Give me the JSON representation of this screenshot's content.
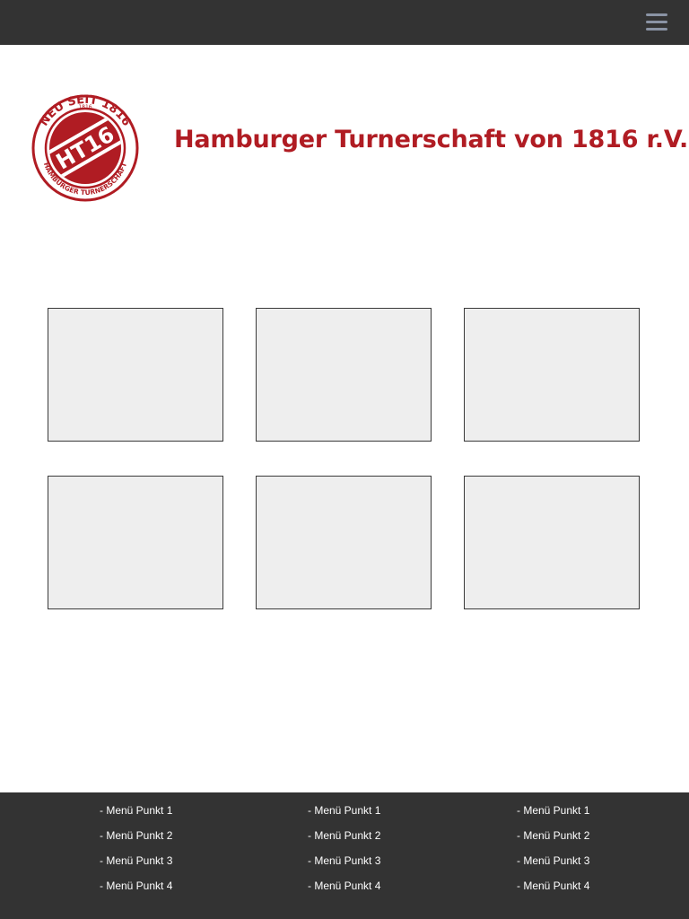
{
  "header": {
    "menu_icon": "hamburger-menu-icon",
    "menu_icon_color": "#8a93a4",
    "background": "#333333"
  },
  "logo": {
    "top_text": "NEU SEIT 1816",
    "year": "1816",
    "center_text": "HT16",
    "bottom_text": "HAMBURGER TURNERSCHAFT",
    "color": "#b01c23"
  },
  "site_title": "Hamburger Turnerschaft von 1816 r.V.",
  "tiles": [
    {
      "id": "tile-1"
    },
    {
      "id": "tile-2"
    },
    {
      "id": "tile-3"
    },
    {
      "id": "tile-4"
    },
    {
      "id": "tile-5"
    },
    {
      "id": "tile-6"
    }
  ],
  "footer": {
    "columns": [
      {
        "links": [
          "- Menü Punkt 1",
          "- Menü Punkt 2",
          "- Menü Punkt 3",
          "- Menü Punkt 4"
        ]
      },
      {
        "links": [
          "- Menü Punkt 1",
          "- Menü Punkt 2",
          "- Menü Punkt 3",
          "- Menü Punkt 4"
        ]
      },
      {
        "links": [
          "- Menü Punkt 1",
          "- Menü Punkt 2",
          "- Menü Punkt 3",
          "- Menü Punkt 4"
        ]
      }
    ]
  }
}
